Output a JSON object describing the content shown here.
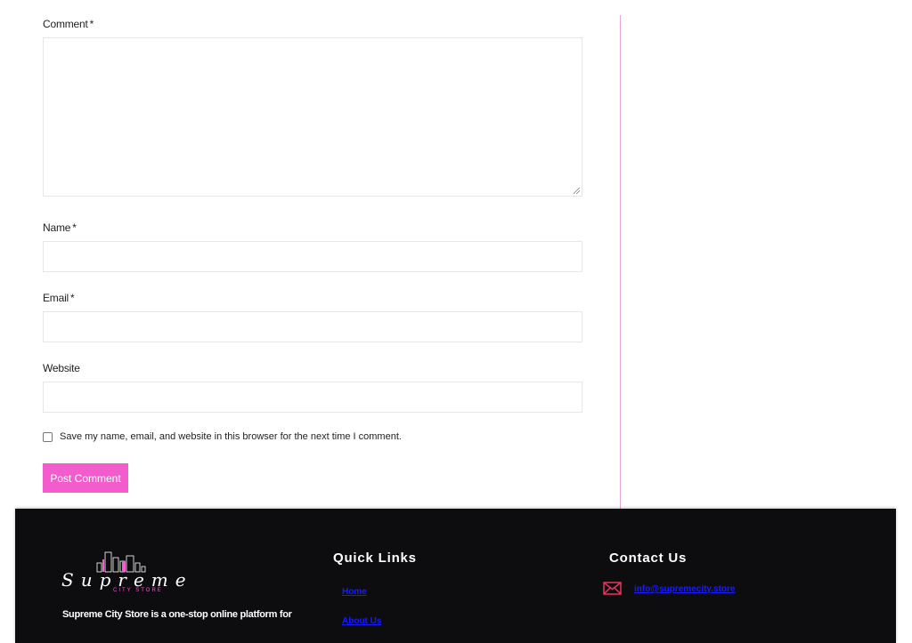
{
  "form": {
    "comment_label": "Comment",
    "name_label": "Name",
    "email_label": "Email",
    "website_label": "Website",
    "required_mark": "*",
    "comment_value": "",
    "name_value": "",
    "email_value": "",
    "website_value": "",
    "consent_checked": false,
    "consent_text": "Save my name, email, and website in this browser for the next time I comment.",
    "submit_label": "Post Comment"
  },
  "footer": {
    "logo": {
      "word": "Supreme",
      "sub": "CITY STORE"
    },
    "about_text": "Supreme City Store is a one-stop online platform for",
    "quick_links": {
      "title": "Quick Links",
      "items": [
        "Home",
        "About Us"
      ]
    },
    "contact": {
      "title": "Contact Us",
      "email": "info@supremecity.store",
      "icon": "mail-icon"
    }
  },
  "colors": {
    "accent": "#f25ccc",
    "divider": "#e7a7de",
    "footer_bg": "#0d0d0f",
    "link": "#1a1aff",
    "mail_icon": "#e8345a"
  }
}
